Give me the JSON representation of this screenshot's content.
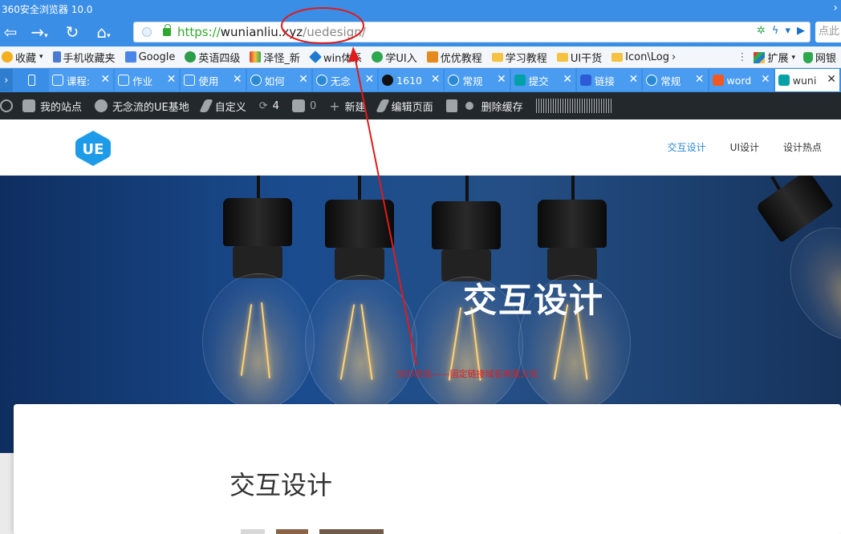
{
  "browser": {
    "title": "360安全浏览器 10.0",
    "url_scheme": "https://",
    "url_host": "wunianliu.xyz",
    "url_path": "/uedesign/",
    "search_placeholder": "点此"
  },
  "bookmarks": [
    {
      "label": "收藏",
      "icon": "star-icon",
      "color": "#f2b01e"
    },
    {
      "label": "手机收藏夹",
      "icon": "phone-icon",
      "color": "#4a7bd0"
    },
    {
      "label": "Google",
      "icon": "google-icon",
      "color": "#4a86e8"
    },
    {
      "label": "英语四级",
      "icon": "circle-icon",
      "color": "#2b9e4a"
    },
    {
      "label": "泽怪_新",
      "icon": "app-icon",
      "color": "#e03a2a"
    },
    {
      "label": "win体系",
      "icon": "diamond-icon",
      "color": "#1f7ad1"
    },
    {
      "label": "学UI入",
      "icon": "leaf-icon",
      "color": "#2ea84e"
    },
    {
      "label": "优优教程",
      "icon": "tiger-icon",
      "color": "#e58a1e"
    },
    {
      "label": "学习教程",
      "icon": "folder-icon",
      "color": "#f5c242"
    },
    {
      "label": "UI干货",
      "icon": "folder-icon",
      "color": "#f5c242"
    },
    {
      "label": "Icon\\Log",
      "icon": "folder-icon",
      "color": "#f5c242"
    }
  ],
  "bookmarks_right": {
    "extensions": "扩展",
    "bank": "网银"
  },
  "tabs": [
    {
      "label": "课程:",
      "icon": "tab-site-icon"
    },
    {
      "label": "作业",
      "icon": "tab-site-icon"
    },
    {
      "label": "使用",
      "icon": "tab-site-icon"
    },
    {
      "label": "如何",
      "icon": "ue-icon"
    },
    {
      "label": "无念",
      "icon": "ue-icon"
    },
    {
      "label": "1610",
      "icon": "github-icon"
    },
    {
      "label": "常规",
      "icon": "ue-icon"
    },
    {
      "label": "提交",
      "icon": "bing-icon"
    },
    {
      "label": "链接",
      "icon": "baidu-icon"
    },
    {
      "label": "常规",
      "icon": "ue-icon"
    },
    {
      "label": "word",
      "icon": "it-icon"
    },
    {
      "label": "wuni",
      "icon": "bing-icon"
    }
  ],
  "wpbar": {
    "my_sites": "我的站点",
    "site_name": "无念流的UE基地",
    "customize": "自定义",
    "updates": "4",
    "comments": "0",
    "new": "新建",
    "edit_page": "编辑页面",
    "clear_cache": "删除缓存"
  },
  "site": {
    "logo_text": "UE",
    "menu": [
      "交互设计",
      "UI设计",
      "设计热点"
    ],
    "active_menu": 0,
    "brand_color": "#2a8ad6"
  },
  "hero": {
    "title": "交互设计"
  },
  "content": {
    "title": "交互设计"
  },
  "annotation": {
    "text": "SEO优化——固定链接域名有意义化",
    "color": "#e01b1b"
  }
}
